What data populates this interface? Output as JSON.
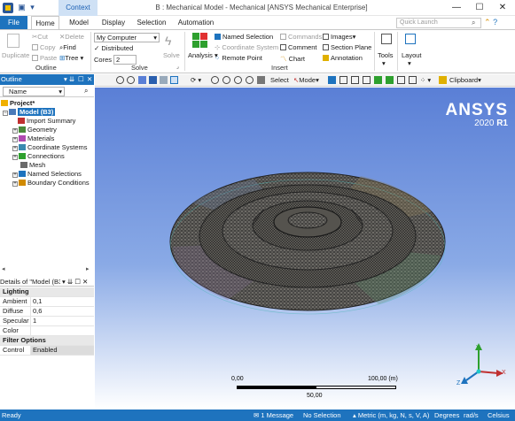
{
  "window": {
    "context_tab": "Context",
    "title": "B : Mechanical Model - Mechanical [ANSYS Mechanical Enterprise]",
    "controls": [
      "—",
      "☐",
      "✕"
    ]
  },
  "menu": {
    "file": "File",
    "tabs": [
      "Home",
      "Model",
      "Display",
      "Selection",
      "Automation"
    ],
    "quick_launch_placeholder": "Quick Launch"
  },
  "ribbon": {
    "outline": {
      "duplicate": "Duplicate",
      "cut": "Cut",
      "copy": "Copy",
      "paste": "Paste",
      "delete": "Delete",
      "find": "Find",
      "tree": "Tree",
      "group_label": "Outline"
    },
    "solve": {
      "computer": "My Computer",
      "distributed": "Distributed",
      "cores_label": "Cores",
      "cores_value": "2",
      "solve": "Solve",
      "group_label": "Solve"
    },
    "insert": {
      "analysis": "Analysis",
      "named_selection": "Named Selection",
      "coordinate_system": "Coordinate System",
      "remote_point": "Remote Point",
      "commands": "Commands",
      "comment": "Comment",
      "chart": "Chart",
      "images": "Images",
      "section_plane": "Section Plane",
      "annotation": "Annotation",
      "group_label": "Insert"
    },
    "tools": "Tools",
    "layout": "Layout"
  },
  "outline": {
    "title": "Outline",
    "filter": "Name",
    "tree": {
      "project": "Project*",
      "model": "Model (B3)",
      "children": [
        "Import Summary",
        "Geometry",
        "Materials",
        "Coordinate Systems",
        "Connections",
        "Mesh",
        "Named Selections",
        "Boundary Conditions"
      ]
    }
  },
  "details": {
    "title": "Details of \"Model (B3) \"",
    "rows": [
      {
        "section": "Lighting"
      },
      {
        "key": "Ambient",
        "value": "0,1"
      },
      {
        "key": "Diffuse",
        "value": "0,6"
      },
      {
        "key": "Specular",
        "value": "1"
      },
      {
        "key": "Color",
        "value": ""
      },
      {
        "section": "Filter Options"
      },
      {
        "key": "Control",
        "value": "Enabled"
      }
    ]
  },
  "viewport_toolbar": {
    "select": "Select",
    "mode": "Mode",
    "clipboard": "Clipboard"
  },
  "viewport": {
    "brand": "ANSYS",
    "version": "2020",
    "release": "R1",
    "scale": {
      "min": "0,00",
      "max": "100,00 (m)",
      "mid": "50,00"
    },
    "triad": {
      "x": "X",
      "y": "Y",
      "z": "Z"
    }
  },
  "status": {
    "ready": "Ready",
    "messages": "1 Message",
    "selection": "No Selection",
    "units": "Metric (m, kg, N, s, V, A)",
    "angle": "Degrees",
    "rate": "rad/s",
    "temp": "Celsius"
  },
  "colors": {
    "accent": "#1e73be",
    "viewport_top": "#5a7fd6",
    "mesh": "#2a2a2a"
  }
}
